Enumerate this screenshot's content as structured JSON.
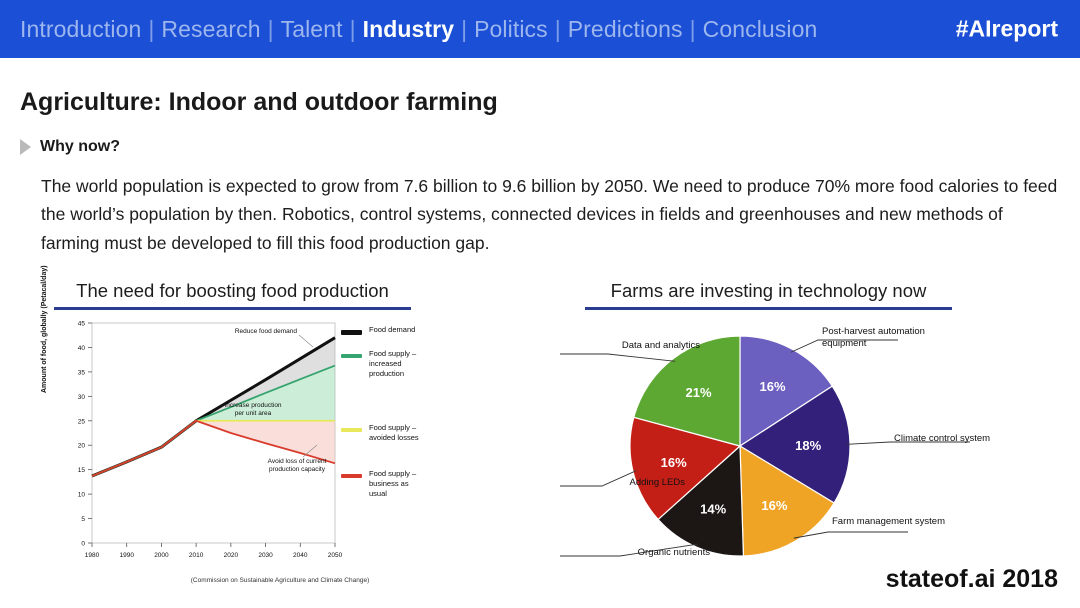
{
  "header": {
    "nav_items": [
      {
        "label": "Introduction",
        "active": false
      },
      {
        "label": "Research",
        "active": false
      },
      {
        "label": "Talent",
        "active": false
      },
      {
        "label": "Industry",
        "active": true
      },
      {
        "label": "Politics",
        "active": false
      },
      {
        "label": "Predictions",
        "active": false
      },
      {
        "label": "Conclusion",
        "active": false
      }
    ],
    "separator": "|",
    "hashtag": "#AIreport",
    "bar_color": "#1a4fd6"
  },
  "slide": {
    "title": "Agriculture: Indoor and outdoor farming",
    "why_label": "Why now?",
    "body": "The world population is expected to grow from 7.6 billion to 9.6 billion by 2050. We need to produce 70% more food calories to feed the world’s population by then. Robotics, control systems, connected devices in fields and greenhouses and new methods of farming must be developed to fill this food production gap.",
    "footer": "stateof.ai 2018",
    "caption_left": "The need for boosting food production",
    "caption_right": "Farms are investing in technology now",
    "caption_underline_color": "#2b3c93"
  },
  "chart_data": [
    {
      "type": "area",
      "title": "The need for boosting food production",
      "xlabel": "",
      "ylabel": "Amount of food, globally (Petacal/day)",
      "source": "(Commission on Sustainable Agriculture and Climate Change)",
      "x": [
        1980,
        1990,
        2000,
        2010,
        2020,
        2030,
        2040,
        2050
      ],
      "xlim": [
        1980,
        2050
      ],
      "ylim": [
        0,
        45
      ],
      "yticks": [
        0,
        5,
        10,
        15,
        20,
        25,
        30,
        35,
        40,
        45
      ],
      "xticks": [
        1980,
        1990,
        2000,
        2010,
        2020,
        2030,
        2040,
        2050
      ],
      "grid": false,
      "legend_position": "right",
      "series": [
        {
          "name": "Food demand",
          "color": "#111111",
          "values": [
            13.7,
            16.6,
            19.6,
            25.0,
            29.2,
            33.4,
            37.7,
            42.0
          ]
        },
        {
          "name": "Food supply – increased production",
          "color": "#35a46e",
          "values": [
            13.7,
            16.6,
            19.6,
            25.0,
            27.8,
            30.7,
            33.5,
            36.3
          ]
        },
        {
          "name": "Food supply – avoided losses",
          "color": "#e8e85a",
          "values": [
            13.7,
            16.6,
            19.6,
            25.0,
            25.0,
            25.0,
            25.0,
            25.0
          ]
        },
        {
          "name": "Food supply – business as usual",
          "color": "#d93b2b",
          "values": [
            13.7,
            16.6,
            19.6,
            25.0,
            22.5,
            20.4,
            18.4,
            16.3
          ]
        }
      ],
      "annotations": [
        "Reduce food demand",
        "Increase production per unit area",
        "Avoid loss of current production capacity"
      ]
    },
    {
      "type": "pie",
      "title": "Farms are investing in technology now",
      "labels": [
        "Post-harvest automation equipment",
        "Climate control system",
        "Farm management system",
        "Organic nutrients",
        "Adding LEDs",
        "Data and analytics"
      ],
      "values": [
        16,
        18,
        16,
        14,
        16,
        21
      ],
      "value_labels": [
        "16%",
        "18%",
        "16%",
        "14%",
        "16%",
        "21%"
      ],
      "colors": [
        "#6b5fc0",
        "#33207a",
        "#f0a426",
        "#1c1715",
        "#c41f16",
        "#5ca832"
      ],
      "legend_position": "callout"
    }
  ]
}
